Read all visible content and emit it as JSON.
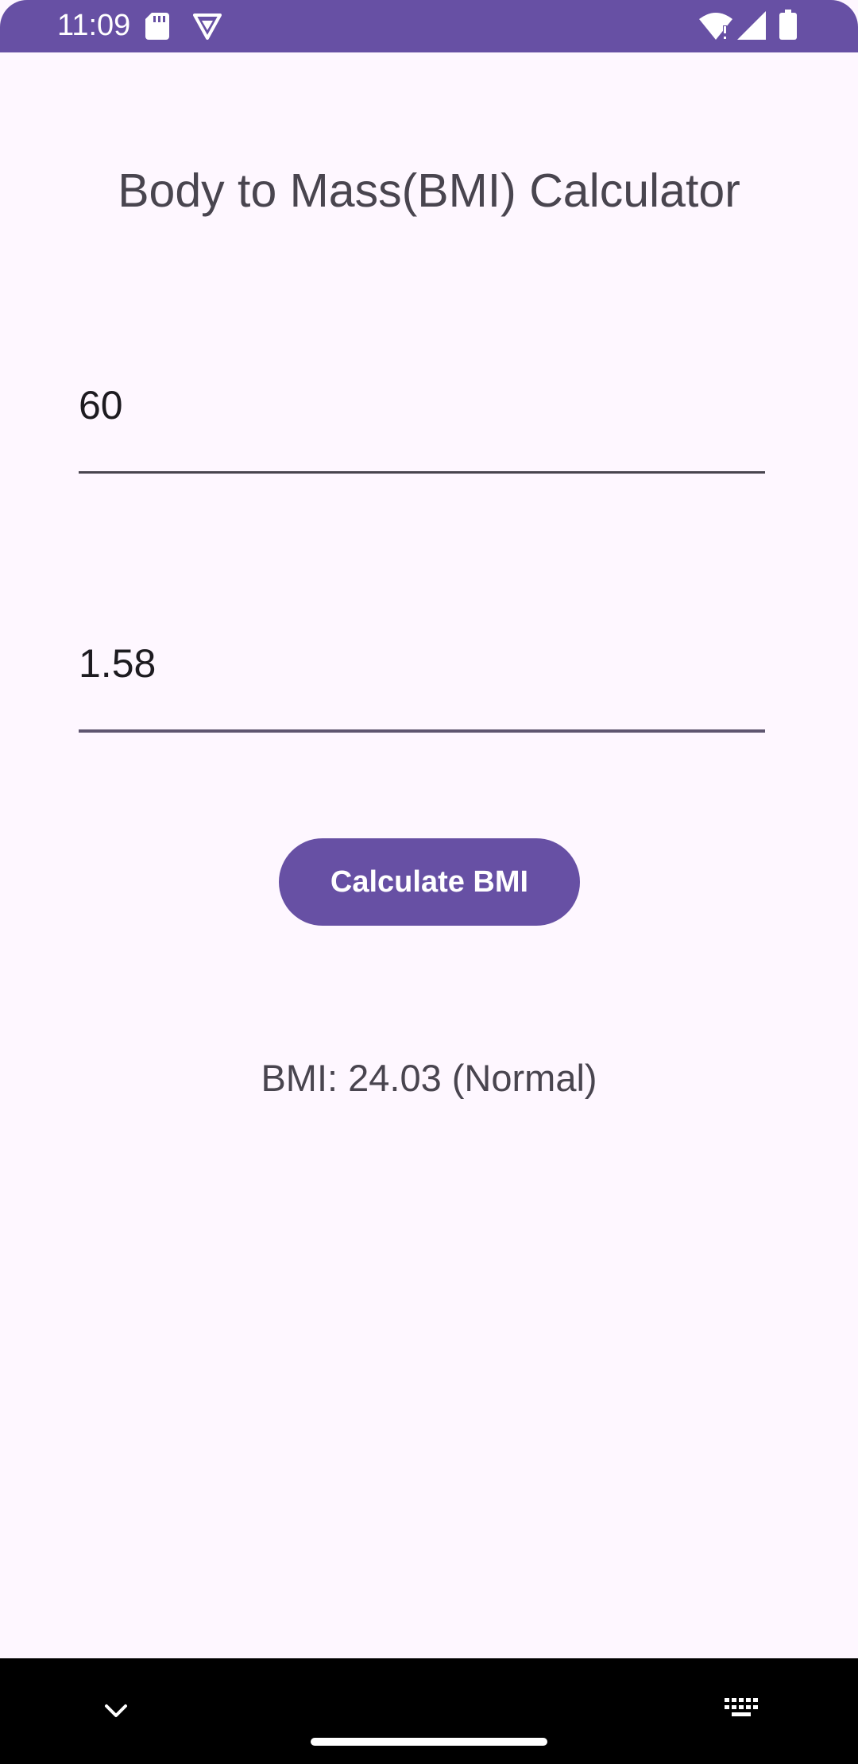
{
  "status_bar": {
    "time": "11:09",
    "background_color": "#6750A4",
    "left_icons": [
      "sd-card-icon",
      "vpn-shield-icon"
    ],
    "right_icons": [
      "wifi-alert-icon",
      "cell-signal-icon",
      "battery-icon"
    ]
  },
  "app": {
    "title": "Body to Mass(BMI) Calculator",
    "weight_input": {
      "value": "60"
    },
    "height_input": {
      "value": "1.58"
    },
    "calculate_button": {
      "label": "Calculate BMI"
    },
    "result_text": "BMI: 24.03 (Normal)",
    "accent_color": "#6750A4",
    "background_color": "#FEF7FF"
  },
  "nav_bar": {
    "icons": [
      "nav-collapse-chevron-icon",
      "home-handle",
      "keyboard-switch-icon"
    ]
  }
}
